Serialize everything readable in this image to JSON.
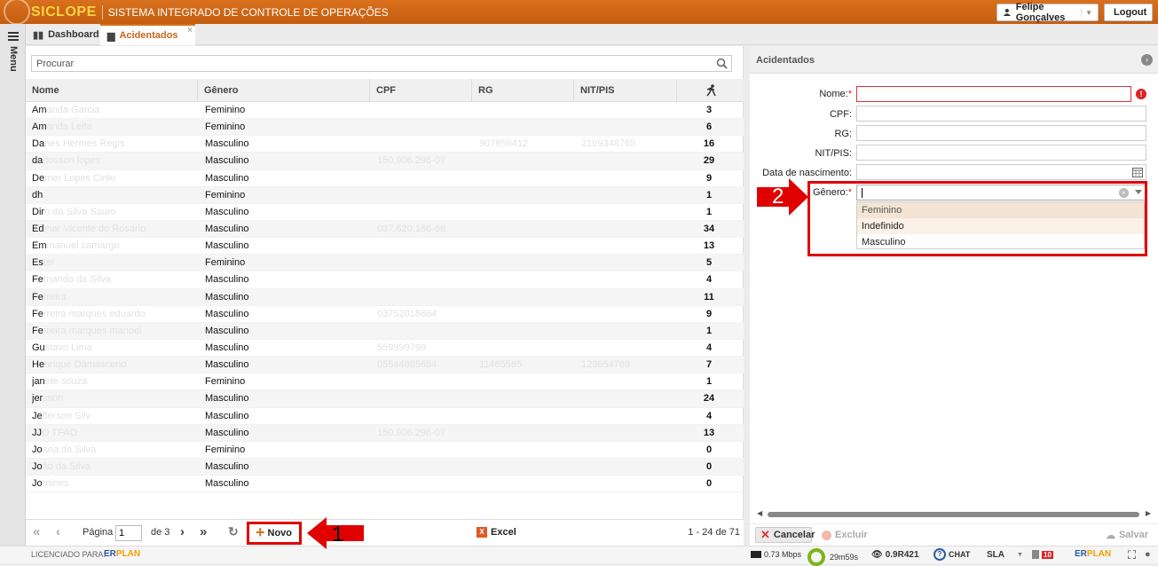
{
  "header": {
    "logo": "SICLOPE",
    "title": "SISTEMA INTEGRADO DE CONTROLE DE OPERAÇÕES",
    "user": "Felipe Gonçalves",
    "logout": "Logout",
    "brand_color": "#d9701d"
  },
  "rail": {
    "menu_label": "Menu"
  },
  "tabs": [
    {
      "label": "Dashboard",
      "icon": "bar-chart-icon"
    },
    {
      "label": "Acidentados",
      "icon": "ambulance-icon",
      "active": true
    }
  ],
  "grid": {
    "search_placeholder": "Procurar",
    "columns": [
      "Nome",
      "Gênero",
      "CPF",
      "RG",
      "NIT/PIS",
      ""
    ],
    "rows": [
      {
        "name": "Am",
        "name_ghost": "anda Garcia",
        "gender": "Feminino",
        "cpf": "",
        "rg": "",
        "nit": "",
        "count": "3"
      },
      {
        "name": "Am",
        "name_ghost": "anda Leite",
        "gender": "Feminino",
        "cpf": "",
        "rg": "",
        "nit": "",
        "count": "6"
      },
      {
        "name": "Da",
        "name_ghost": "nes Hermes Regis",
        "gender": "Masculino",
        "cpf": "",
        "rg": "907856412",
        "nit": "2109348765",
        "count": "16"
      },
      {
        "name": "da",
        "name_ghost": "dosson lopes",
        "gender": "Masculino",
        "cpf": "150.906.296-07",
        "rg": "",
        "nit": "",
        "count": "29"
      },
      {
        "name": "De",
        "name_ghost": "mer Lopes Cirilo",
        "gender": "Masculino",
        "cpf": "",
        "rg": "",
        "nit": "",
        "count": "9"
      },
      {
        "name": "dh",
        "name_ghost": "",
        "gender": "Feminino",
        "cpf": "",
        "rg": "",
        "nit": "",
        "count": "1"
      },
      {
        "name": "Dir",
        "name_ghost": "o da Silva Sauro",
        "gender": "Masculino",
        "cpf": "",
        "rg": "",
        "nit": "",
        "count": "1"
      },
      {
        "name": "Ed",
        "name_ghost": "mar Vicente do Rosario",
        "gender": "Masculino",
        "cpf": "037.620.186-68",
        "rg": "",
        "nit": "",
        "count": "34"
      },
      {
        "name": "Em",
        "name_ghost": "manuel camargo",
        "gender": "Masculino",
        "cpf": "",
        "rg": "",
        "nit": "",
        "count": "13"
      },
      {
        "name": "Es",
        "name_ghost": "ter",
        "gender": "Feminino",
        "cpf": "",
        "rg": "",
        "nit": "",
        "count": "5"
      },
      {
        "name": "Fe",
        "name_ghost": "rnando da Silva",
        "gender": "Masculino",
        "cpf": "",
        "rg": "",
        "nit": "",
        "count": "4"
      },
      {
        "name": "Fe",
        "name_ghost": "rreira",
        "gender": "Masculino",
        "cpf": "",
        "rg": "",
        "nit": "",
        "count": "11"
      },
      {
        "name": "Fe",
        "name_ghost": "rreira marques eduardo",
        "gender": "Masculino",
        "cpf": "03752018664",
        "rg": "",
        "nit": "",
        "count": "9"
      },
      {
        "name": "Fe",
        "name_ghost": "rreira marques manoel",
        "gender": "Masculino",
        "cpf": "",
        "rg": "",
        "nit": "",
        "count": "1"
      },
      {
        "name": "Gu",
        "name_ghost": "stavo Lima",
        "gender": "Masculino",
        "cpf": "559999790",
        "rg": "",
        "nit": "",
        "count": "4"
      },
      {
        "name": "He",
        "name_ghost": "nrique Damasceno",
        "gender": "Masculino",
        "cpf": "05544885654",
        "rg": "11465565",
        "nit": "123654789",
        "count": "7"
      },
      {
        "name": "jan",
        "name_ghost": "ete souza",
        "gender": "Feminino",
        "cpf": "",
        "rg": "",
        "nit": "",
        "count": "1"
      },
      {
        "name": "jer",
        "name_ghost": "sson",
        "gender": "Masculino",
        "cpf": "",
        "rg": "",
        "nit": "",
        "count": "24"
      },
      {
        "name": "Je",
        "name_ghost": "fferson Silv",
        "gender": "Masculino",
        "cpf": "",
        "rg": "",
        "nit": "",
        "count": "4"
      },
      {
        "name": "JJ",
        "name_ghost": "O TFAO",
        "gender": "Masculino",
        "cpf": "150.906.296-07",
        "rg": "",
        "nit": "",
        "count": "13"
      },
      {
        "name": "Jo",
        "name_ghost": "ana da Silva",
        "gender": "Feminino",
        "cpf": "",
        "rg": "",
        "nit": "",
        "count": "0"
      },
      {
        "name": "Jo",
        "name_ghost": "ão da Silva",
        "gender": "Masculino",
        "cpf": "",
        "rg": "",
        "nit": "",
        "count": "0"
      },
      {
        "name": "Jo",
        "name_ghost": "rnines",
        "gender": "Masculino",
        "cpf": "",
        "rg": "",
        "nit": "",
        "count": "0"
      }
    ],
    "footer": {
      "page_label": "Página",
      "page_value": "1",
      "of_pages": "de 3",
      "novo": "Novo",
      "excel": "Excel",
      "range": "1 - 24 de 71"
    }
  },
  "form": {
    "title": "Acidentados",
    "fields": {
      "nome": "Nome:",
      "cpf": "CPF:",
      "rg": "RG:",
      "nit": "NIT/PIS:",
      "nascimento": "Data de nascimento:",
      "genero": "Gênero:"
    },
    "required_mark": "*",
    "gender_options": [
      "Feminino",
      "Indefinido",
      "Masculino"
    ],
    "buttons": {
      "cancelar": "Cancelar",
      "excluir": "Excluir",
      "salvar": "Salvar"
    }
  },
  "status": {
    "licensed": "LICENCIADO PARA:",
    "brand_er": "ER",
    "brand_plan": "PLAN",
    "speed": "0.73 Mbps",
    "time": "29m59s",
    "version": "0.9R421",
    "chat": "CHAT",
    "sla": "SLA",
    "badge": "10"
  },
  "annotations": {
    "one": "1",
    "two": "2",
    "color": "#e00000"
  }
}
